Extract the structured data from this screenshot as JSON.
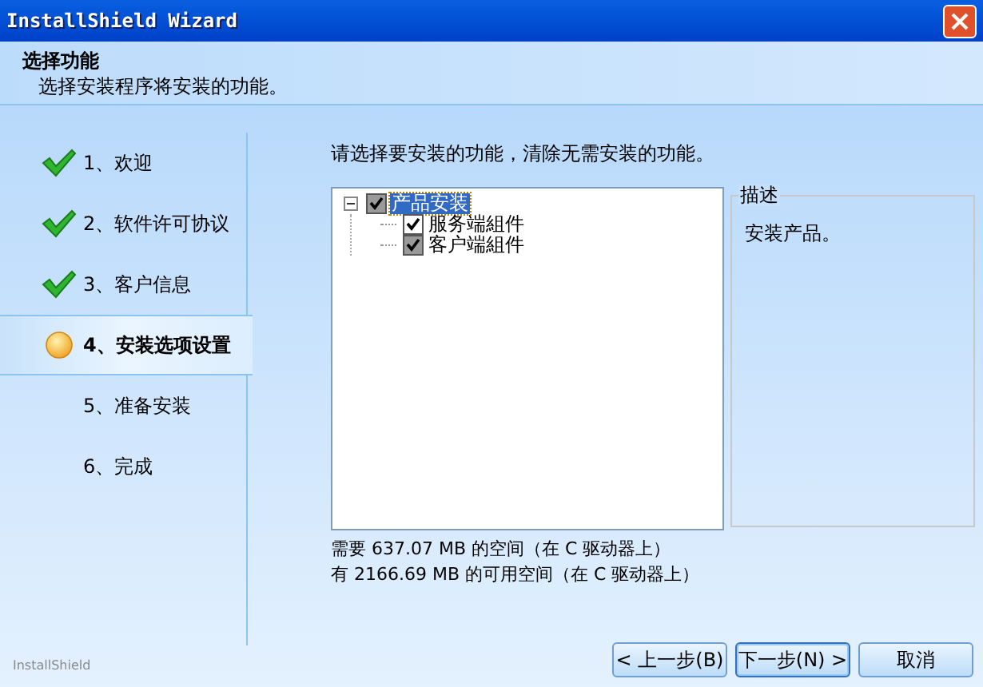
{
  "window": {
    "title": "InstallShield Wizard"
  },
  "header": {
    "title": "选择功能",
    "subtitle": "选择安装程序将安装的功能。"
  },
  "steps": [
    {
      "label": "1、欢迎",
      "completed": true,
      "selected": false
    },
    {
      "label": "2、软件许可协议",
      "completed": true,
      "selected": false
    },
    {
      "label": "3、客户信息",
      "completed": true,
      "selected": false
    },
    {
      "label": "4、安装选项设置",
      "selected": true
    },
    {
      "label": "5、准备安装",
      "completed": false,
      "selected": false
    },
    {
      "label": "6、完成",
      "completed": false,
      "selected": false
    }
  ],
  "instruction": "请选择要安装的功能，清除无需安装的功能。",
  "feature_tree": [
    {
      "label": "产品安装",
      "kind": "shaded",
      "checked": true,
      "selected": true,
      "expanded": true,
      "children": [
        {
          "label": "服务端組件",
          "kind": "plain",
          "checked": true,
          "selected": false
        },
        {
          "label": "客户端組件",
          "kind": "shaded",
          "checked": true,
          "selected": false
        }
      ]
    }
  ],
  "description": {
    "title": "描述",
    "text": "安装产品。"
  },
  "disk_space": [
    "需要 637.07 MB 的空间（在 C 驱动器上）",
    "有 2166.69 MB 的可用空间（在 C 驱动器上）"
  ],
  "brand": "InstallShield",
  "buttons": [
    {
      "label": "< 上一步(B)",
      "focused": false
    },
    {
      "label": "下一步(N) >",
      "focused": true
    },
    {
      "label": "取消",
      "focused": false
    }
  ]
}
